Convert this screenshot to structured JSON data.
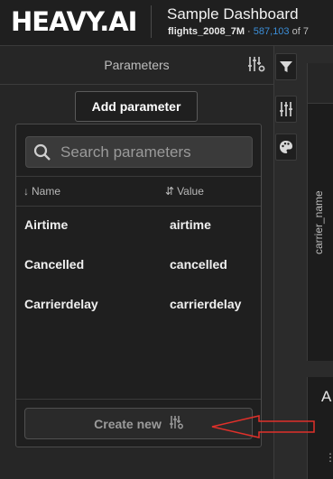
{
  "header": {
    "logo": "HEAVY.AI",
    "dashboard_title": "Sample Dashboard",
    "dataset": "flights_2008_7M",
    "separator": "·",
    "record_count": "587,103",
    "count_suffix": "of 7"
  },
  "panel": {
    "title": "Parameters",
    "add_button": "Add parameter"
  },
  "popup": {
    "search_placeholder": "Search parameters",
    "columns": {
      "name": "Name",
      "value": "Value"
    },
    "rows": [
      {
        "name": "Airtime",
        "value": "airtime"
      },
      {
        "name": "Cancelled",
        "value": "cancelled"
      },
      {
        "name": "Carrierdelay",
        "value": "carrierdelay"
      }
    ],
    "create_button": "Create new"
  },
  "background": {
    "axis_label": "carrier_name",
    "card_title": "A",
    "card_dots": "⋮"
  },
  "colors": {
    "accent_count": "#3b8ed8",
    "annotation_arrow": "#e0302a"
  },
  "icons": {
    "filter": "filter-icon",
    "settings": "sliders-icon",
    "theme": "palette-icon",
    "search": "search-icon"
  }
}
